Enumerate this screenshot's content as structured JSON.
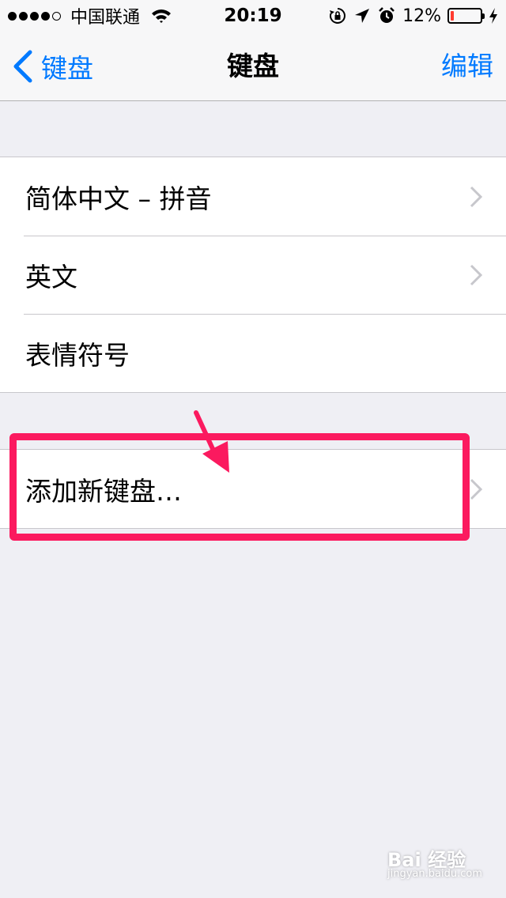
{
  "status_bar": {
    "carrier": "中国联通",
    "time": "20:19",
    "battery_percent": "12%",
    "battery_level": 0.12,
    "battery_color": "#ff3b30",
    "signal_dots_filled": 4,
    "signal_dots_total": 5,
    "icons": [
      "wifi-icon",
      "rotation-lock-icon",
      "location-arrow-icon",
      "alarm-clock-icon",
      "battery-icon",
      "charging-bolt-icon"
    ]
  },
  "nav": {
    "back_label": "键盘",
    "title": "键盘",
    "edit_label": "编辑",
    "accent_color": "#007aff"
  },
  "keyboards": [
    {
      "label": "简体中文 – 拼音",
      "has_chevron": true
    },
    {
      "label": "英文",
      "has_chevron": true
    },
    {
      "label": "表情符号",
      "has_chevron": false
    }
  ],
  "add_keyboard": {
    "label": "添加新键盘…",
    "has_chevron": true
  },
  "annotation": {
    "color": "#fb1a5f"
  },
  "watermark": {
    "brand": "Bai 经验",
    "url": "jingyan.baidu.com"
  }
}
